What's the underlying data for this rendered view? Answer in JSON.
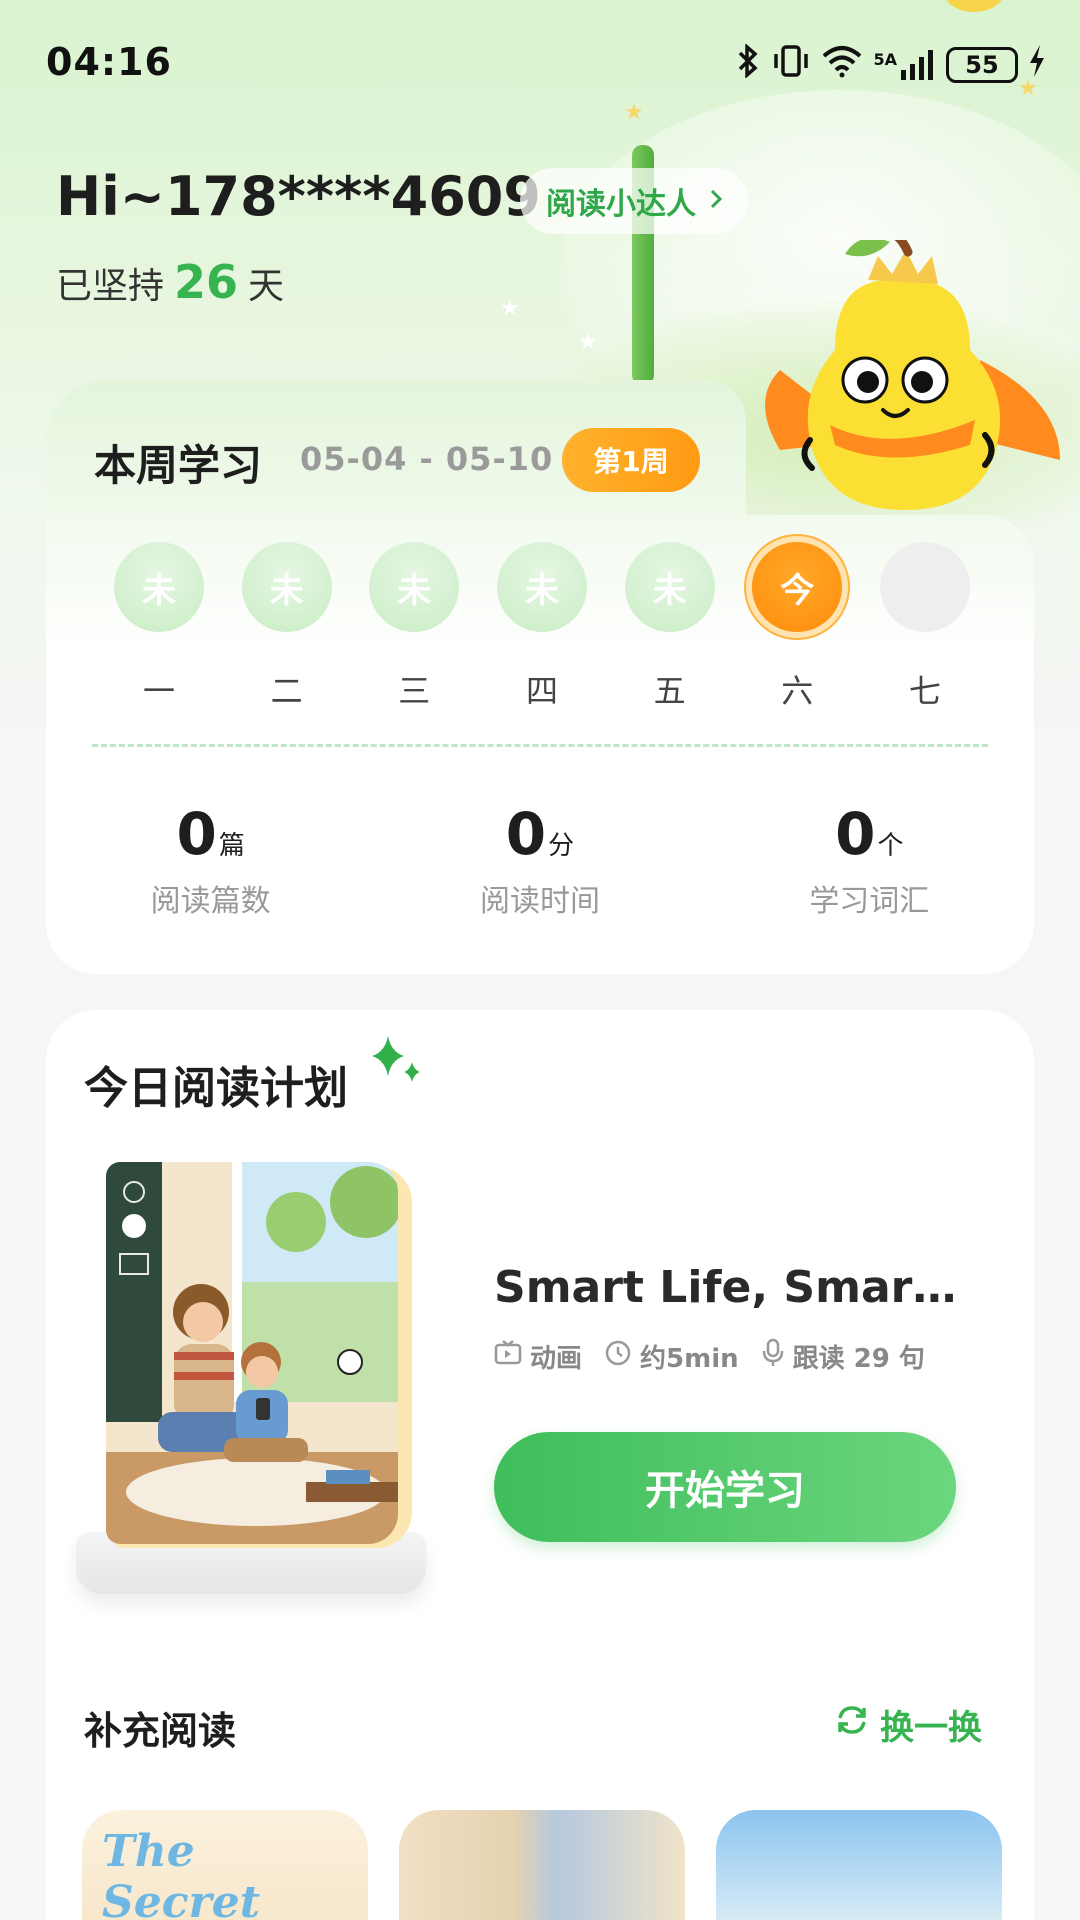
{
  "status_bar": {
    "time": "04:16",
    "network": "5A",
    "battery": "55"
  },
  "header": {
    "greeting": "Hi~178****4609",
    "badge_label": "阅读小达人",
    "streak_prefix": "已坚持",
    "streak_days": "26",
    "streak_suffix": "天"
  },
  "week": {
    "title": "本周学习",
    "range": "05-04 - 05-10",
    "badge": "第1周",
    "days": [
      {
        "label": "一",
        "status": "未"
      },
      {
        "label": "二",
        "status": "未"
      },
      {
        "label": "三",
        "status": "未"
      },
      {
        "label": "四",
        "status": "未"
      },
      {
        "label": "五",
        "status": "未"
      },
      {
        "label": "六",
        "status": "今"
      },
      {
        "label": "七",
        "status": ""
      }
    ],
    "stats": [
      {
        "value": "0",
        "unit": "篇",
        "label": "阅读篇数"
      },
      {
        "value": "0",
        "unit": "分",
        "label": "阅读时间"
      },
      {
        "value": "0",
        "unit": "个",
        "label": "学习词汇"
      }
    ]
  },
  "plan": {
    "title": "今日阅读计划",
    "book_title": "Smart Life, Smart ...",
    "meta": {
      "type": "动画",
      "duration": "约5min",
      "follow_read": "跟读 29 句"
    },
    "start_button": "开始学习"
  },
  "supplement": {
    "title": "补充阅读",
    "refresh_label": "换一换",
    "first_book_text": "The Secret"
  },
  "colors": {
    "accent_green": "#36b44f",
    "badge_orange": "#ff9a12"
  }
}
